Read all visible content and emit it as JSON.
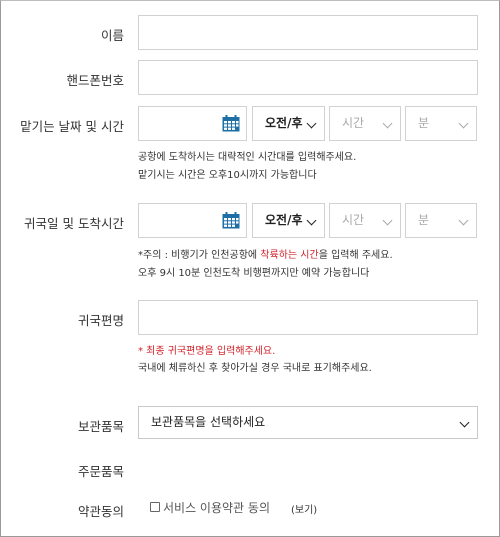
{
  "form": {
    "name_label": "이름",
    "phone_label": "핸드폰번호",
    "dropoff": {
      "label": "맡기는 날짜 및 시간",
      "ampm": "오전/후",
      "hour_placeholder": "시간",
      "minute_placeholder": "분",
      "note1": "공항에 도착하시는 대략적인 시간대를 입력해주세요.",
      "note2": "맡기시는 시간은 오후10시까지 가능합니다"
    },
    "return": {
      "label": "귀국일 및 도착시간",
      "ampm": "오전/후",
      "hour_placeholder": "시간",
      "minute_placeholder": "분",
      "note1_prefix": "*주의 : 비행기가 인천공항에 ",
      "note1_red": "착륙하는 시간",
      "note1_suffix": "을 입력해 주세요.",
      "note2": "오후 9시 10분 인천도착 비행편까지만 예약 가능합니다"
    },
    "flight": {
      "label": "귀국편명",
      "note1": "* 최종 귀국편명을 입력해주세요.",
      "note2": "국내에 체류하신 후 찾아가실 경우 국내로 표기해주세요."
    },
    "storage": {
      "label": "보관품목",
      "selected": "보관품목을 선택하세요"
    },
    "order_label": "주문품목",
    "terms": {
      "label": "약관동의",
      "checkbox_text": "서비스 이용약관 동의",
      "view_link": "(보기)"
    }
  },
  "colors": {
    "accent_calendar": "#1d6fa5",
    "warning_red": "#d0242b"
  }
}
